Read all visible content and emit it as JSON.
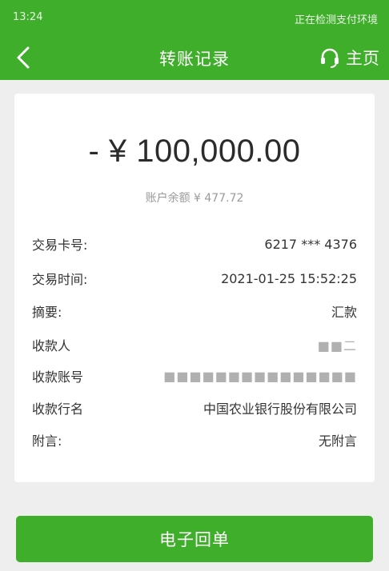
{
  "status_bar": {
    "time": "13:24",
    "right_text": "正在检测支付环境"
  },
  "header": {
    "title": "转账记录",
    "home_label": "主页"
  },
  "transaction": {
    "amount": "- ¥ 100,000.00",
    "balance": "账户余额 ¥ 477.72",
    "fields": [
      {
        "label": "交易卡号:",
        "value": "6217 *** 4376"
      },
      {
        "label": "交易时间:",
        "value": "2021-01-25 15:52:25"
      },
      {
        "label": "摘要:",
        "value": "汇款"
      },
      {
        "label": "收款人",
        "value": "■■二"
      },
      {
        "label": "收款账号",
        "value": "■■■■■■■■■■■■■■■"
      },
      {
        "label": "收款行名",
        "value": "中国农业银行股份有限公司"
      },
      {
        "label": "附言:",
        "value": "无附言"
      }
    ]
  },
  "receipt_button": {
    "label": "电子回单"
  },
  "colors": {
    "brand_green": "#3fae2a",
    "card_bg": "#ffffff",
    "page_bg": "#eeeeee"
  }
}
